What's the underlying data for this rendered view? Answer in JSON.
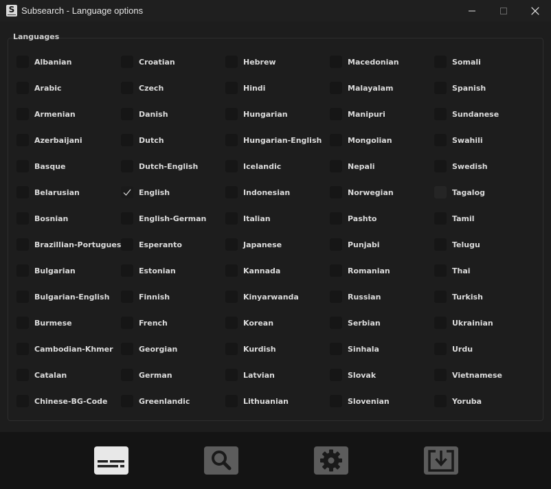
{
  "window": {
    "title": "Subsearch - Language options",
    "app_icon_letter": "S"
  },
  "group": {
    "title": "Languages"
  },
  "languages": {
    "col0": [
      "Albanian",
      "Arabic",
      "Armenian",
      "Azerbaijani",
      "Basque",
      "Belarusian",
      "Bosnian",
      "Brazillian-Portuguese",
      "Bulgarian",
      "Bulgarian-English",
      "Burmese",
      "Cambodian-Khmer",
      "Catalan",
      "Chinese-BG-Code"
    ],
    "col1": [
      "Croatian",
      "Czech",
      "Danish",
      "Dutch",
      "Dutch-English",
      "English",
      "English-German",
      "Esperanto",
      "Estonian",
      "Finnish",
      "French",
      "Georgian",
      "German",
      "Greenlandic"
    ],
    "col2": [
      "Hebrew",
      "Hindi",
      "Hungarian",
      "Hungarian-English",
      "Icelandic",
      "Indonesian",
      "Italian",
      "Japanese",
      "Kannada",
      "Kinyarwanda",
      "Korean",
      "Kurdish",
      "Latvian",
      "Lithuanian"
    ],
    "col3": [
      "Macedonian",
      "Malayalam",
      "Manipuri",
      "Mongolian",
      "Nepali",
      "Norwegian",
      "Pashto",
      "Punjabi",
      "Romanian",
      "Russian",
      "Serbian",
      "Sinhala",
      "Slovak",
      "Slovenian"
    ],
    "col4": [
      "Somali",
      "Spanish",
      "Sundanese",
      "Swahili",
      "Swedish",
      "Tagalog",
      "Tamil",
      "Telugu",
      "Thai",
      "Turkish",
      "Ukrainian",
      "Urdu",
      "Vietnamese",
      "Yoruba"
    ]
  },
  "checked": [
    "English"
  ],
  "hovered": [
    "Tagalog"
  ],
  "toolbar": {
    "buttons": [
      {
        "name": "language-options-button",
        "icon": "subtitles-icon",
        "active": true
      },
      {
        "name": "search-button",
        "icon": "search-icon",
        "active": false
      },
      {
        "name": "settings-button",
        "icon": "gear-icon",
        "active": false
      },
      {
        "name": "download-button",
        "icon": "download-icon",
        "active": false
      }
    ]
  },
  "colors": {
    "background": "#1d1d1d",
    "checkbox": "#161616",
    "text": "#dcdcdc",
    "toolbar_active": "#e8e8e8",
    "toolbar_inactive": "#5c5c5c"
  }
}
